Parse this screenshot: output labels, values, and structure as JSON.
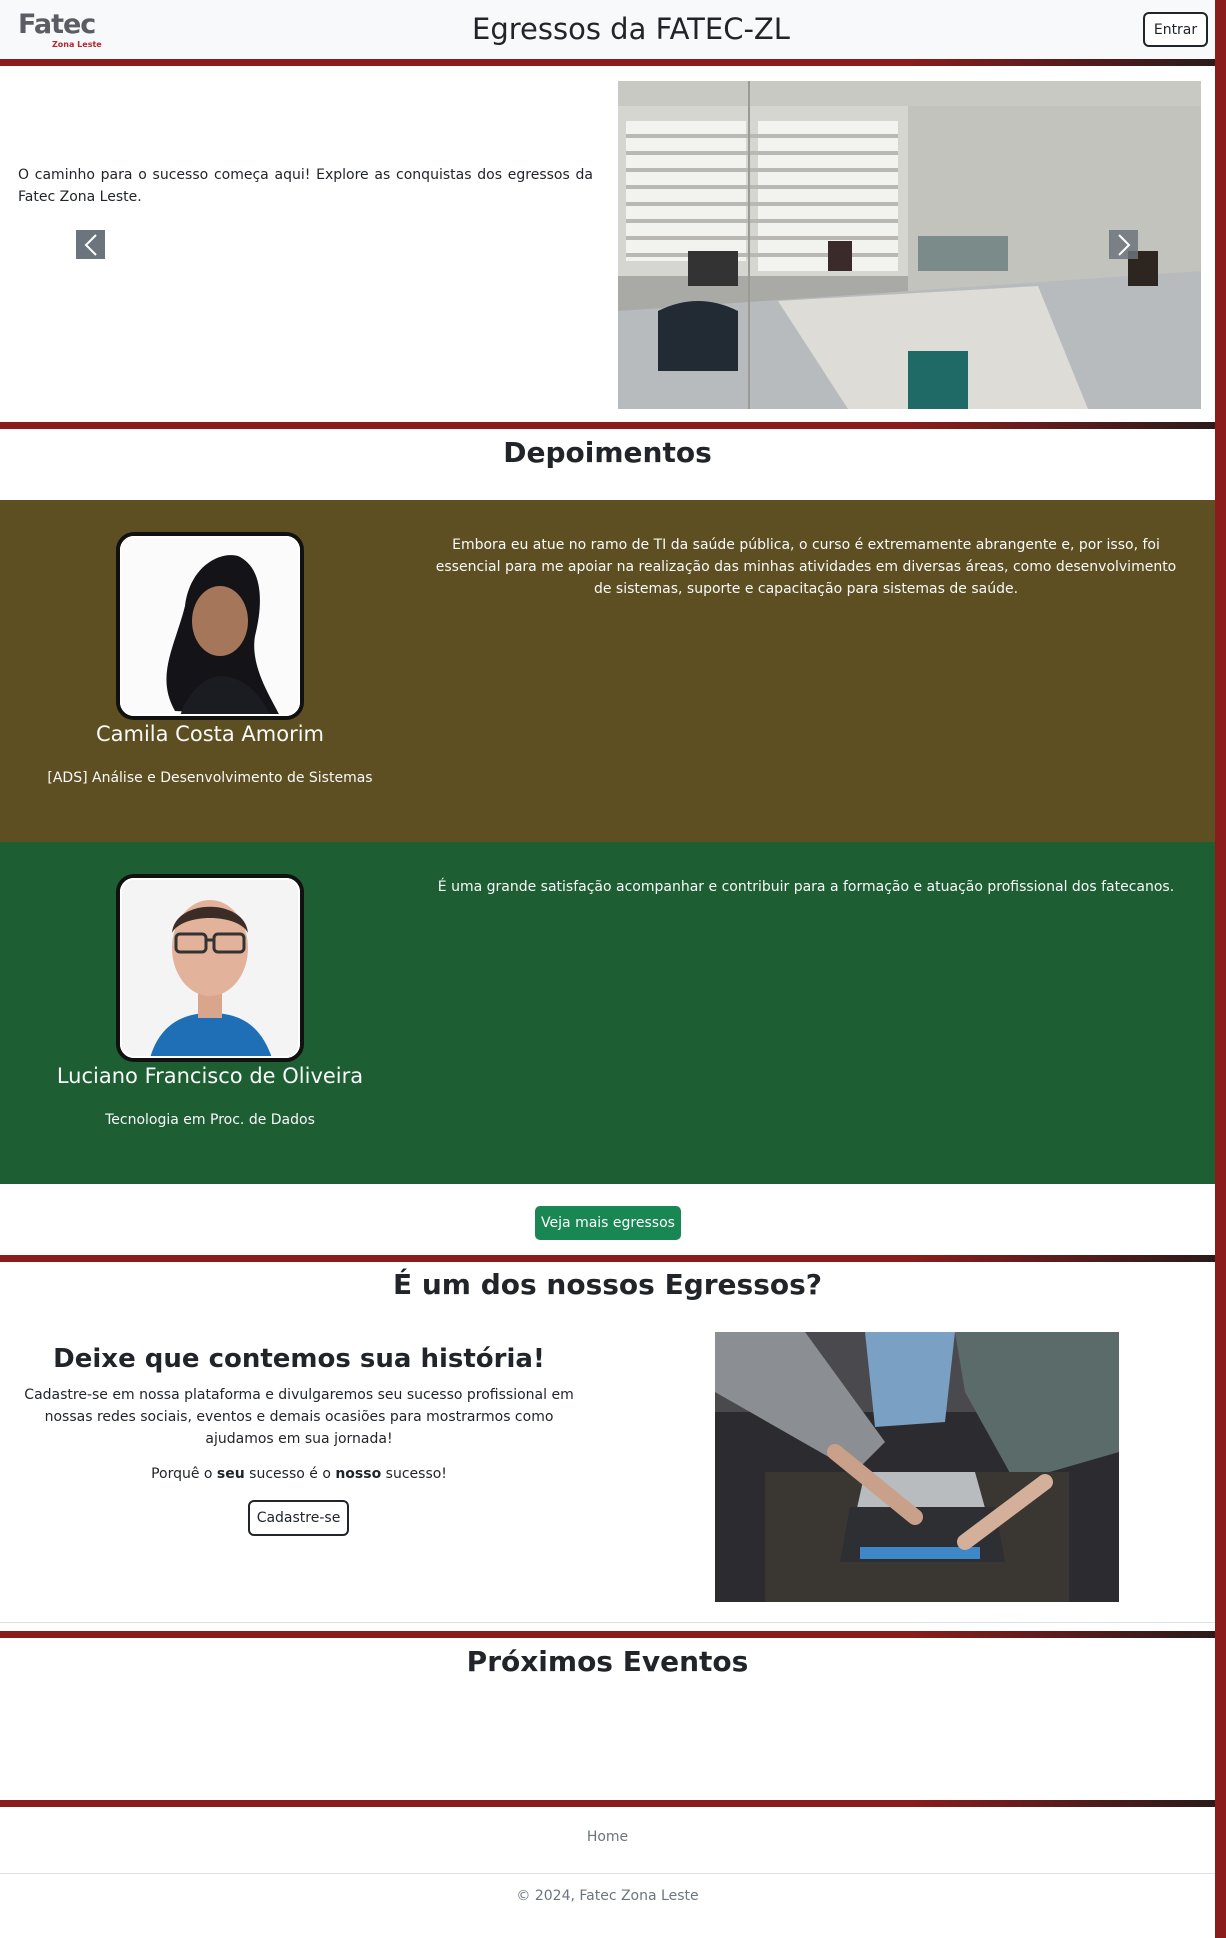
{
  "header": {
    "logo_text": "Fatec",
    "logo_subtext": "Zona Leste",
    "title": "Egressos da FATEC-ZL",
    "login_label": "Entrar"
  },
  "hero": {
    "text": "O caminho para o sucesso começa aqui! Explore as conquistas dos egressos da Fatec Zona Leste.",
    "prev_icon": "chevron-left-icon",
    "next_icon": "chevron-right-icon"
  },
  "testimonials": {
    "title": "Depoimentos",
    "items": [
      {
        "name": "Camila Costa Amorim",
        "course": "[ADS] Análise e Desenvolvimento de Sistemas",
        "quote": "Embora eu atue no ramo de TI da saúde pública, o curso é extremamente abrangente e, por isso, foi essencial para me apoiar na realização das minhas atividades em diversas áreas, como desenvolvimento de sistemas, suporte e capacitação para sistemas de saúde.",
        "bg_color": "#5e4f22"
      },
      {
        "name": "Luciano Francisco de Oliveira",
        "course": "Tecnologia em Proc. de Dados",
        "quote": "É uma grande satisfação acompanhar e contribuir para a formação e atuação profissional dos fatecanos.",
        "bg_color": "#1e5e33"
      }
    ],
    "more_label": "Veja mais egressos"
  },
  "alumni": {
    "title": "É um dos nossos Egressos?",
    "subtitle": "Deixe que contemos sua história!",
    "paragraph": "Cadastre-se em nossa plataforma e divulgaremos seu sucesso profissional em nossas redes sociais, eventos e demais ocasiões para mostrarmos como ajudamos em sua jornada!",
    "slogan_1": "Porquê o ",
    "slogan_bold_1": "seu",
    "slogan_2": " sucesso é o ",
    "slogan_bold_2": "nosso",
    "slogan_3": " sucesso!",
    "signup_label": "Cadastre-se"
  },
  "events": {
    "title": "Próximos Eventos"
  },
  "footer": {
    "home_link": "Home",
    "copyright": "© 2024, Fatec Zona Leste"
  },
  "colors": {
    "brand_red": "#8a1c1c",
    "success_green": "#198754"
  }
}
